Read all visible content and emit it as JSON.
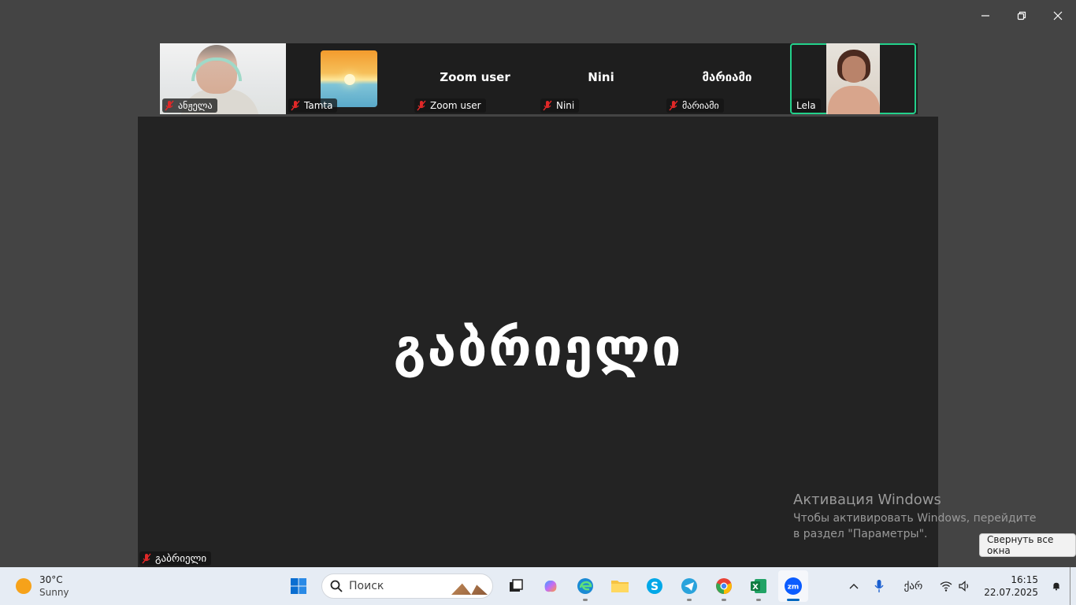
{
  "window_controls": {
    "minimize": "—",
    "restore": "❐",
    "close": "✕"
  },
  "participants": [
    {
      "name": "ანჟელა",
      "type": "video",
      "muted": true,
      "active": false
    },
    {
      "name": "Tamta",
      "type": "picture",
      "muted": true,
      "active": false
    },
    {
      "name": "Zoom user",
      "display": "Zoom user",
      "type": "name",
      "muted": true,
      "active": false
    },
    {
      "name": "Nini",
      "display": "Nini",
      "type": "name",
      "muted": true,
      "active": false
    },
    {
      "name": "მარიამი",
      "display": "მარიამი",
      "type": "name",
      "muted": true,
      "active": false
    },
    {
      "name": "Lela",
      "type": "video",
      "muted": false,
      "active": true
    }
  ],
  "main_speaker": {
    "display": "გაბრიელი",
    "chip": "გაბრიელი",
    "muted": true
  },
  "activation": {
    "title": "Активация Windows",
    "line": "Чтобы активировать Windows, перейдите в раздел \"Параметры\"."
  },
  "tooltip": "Свернуть все окна",
  "taskbar": {
    "weather": {
      "temp": "30°C",
      "condition": "Sunny"
    },
    "search_placeholder": "Поиск",
    "apps": [
      "start-icon",
      "search",
      "task-view-icon",
      "copilot-icon",
      "edge-icon",
      "file-explorer-icon",
      "skype-icon",
      "telegram-icon",
      "chrome-icon",
      "excel-icon",
      "zoom-icon"
    ],
    "tray": {
      "language": "ქარ",
      "time": "16:15",
      "date": "22.07.2025"
    }
  },
  "colors": {
    "active_border": "#23d18b",
    "mic_off": "#e02828",
    "main_bg": "#232323",
    "desktop_bg": "#444444"
  }
}
